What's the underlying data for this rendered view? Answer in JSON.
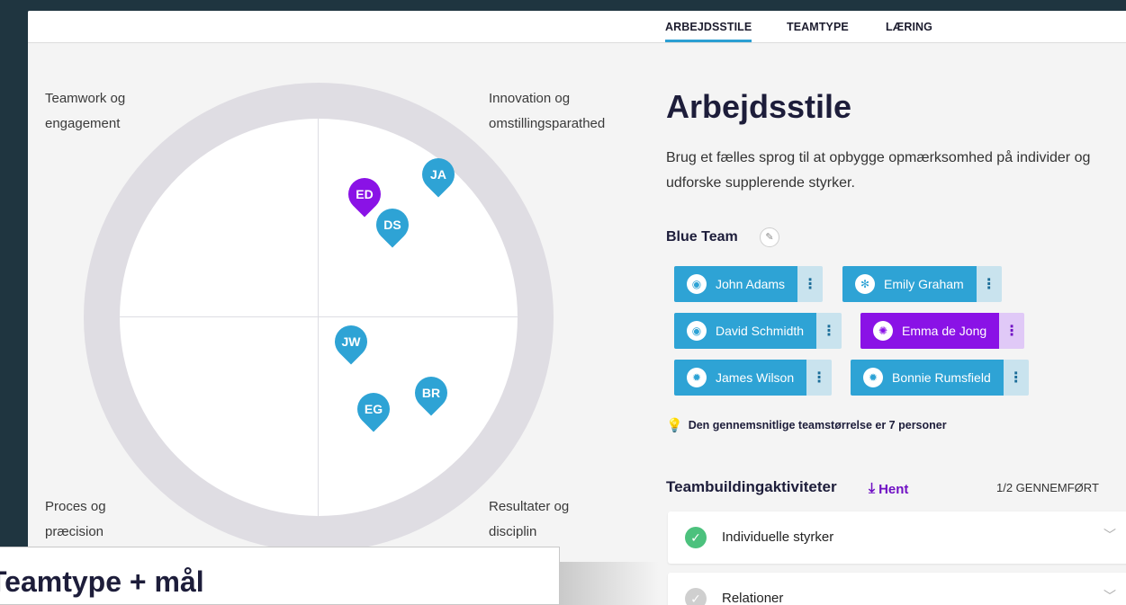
{
  "tabs": [
    {
      "label": "ARBEJDSSTILE",
      "active": true
    },
    {
      "label": "TEAMTYPE",
      "active": false
    },
    {
      "label": "LÆRING",
      "active": false
    }
  ],
  "quadrants": {
    "top_left": [
      "Teamwork og",
      "engagement"
    ],
    "top_right": [
      "Innovation og",
      "omstillingsparathed"
    ],
    "bottom_left": [
      "Proces og",
      "præcision"
    ],
    "bottom_right": [
      "Resultater og",
      "disciplin"
    ]
  },
  "pins": [
    {
      "initials": "ED",
      "color": "#8a12e6"
    },
    {
      "initials": "JA",
      "color": "#2ea3d5"
    },
    {
      "initials": "DS",
      "color": "#2ea3d5"
    },
    {
      "initials": "JW",
      "color": "#2ea3d5"
    },
    {
      "initials": "BR",
      "color": "#2ea3d5"
    },
    {
      "initials": "EG",
      "color": "#2ea3d5"
    }
  ],
  "main": {
    "title": "Arbejdsstile",
    "description": "Brug et fælles sprog til at opbygge opmærksomhed på individer og udforske supplerende styrker.",
    "team_name": "Blue Team"
  },
  "members": [
    {
      "name": "John Adams",
      "color": "#2ea3d5"
    },
    {
      "name": "Emily Graham",
      "color": "#2ea3d5"
    },
    {
      "name": "David Schmidth",
      "color": "#2ea3d5"
    },
    {
      "name": "Emma de Jong",
      "color": "#8a12e6"
    },
    {
      "name": "James Wilson",
      "color": "#2ea3d5"
    },
    {
      "name": "Bonnie Rumsfield",
      "color": "#2ea3d5"
    }
  ],
  "menu_glyph": "⋮",
  "average_note": "Den gennemsnitlige teamstørrelse er 7 personer",
  "activities": {
    "title": "Teambuildingaktiviteter",
    "download_label": "Hent",
    "progress": "1/2 GENNEMFØRT",
    "items": [
      {
        "label": "Individuelle styrker",
        "done": true
      },
      {
        "label": "Relationer",
        "done": false
      }
    ]
  },
  "overlay": {
    "title": "Teamtype + mål"
  },
  "icons": {
    "edit": "pencil-icon",
    "bulb": "lightbulb-icon",
    "download": "download-icon",
    "check": "check-circle-icon",
    "chevron": "chevron-down-icon"
  }
}
